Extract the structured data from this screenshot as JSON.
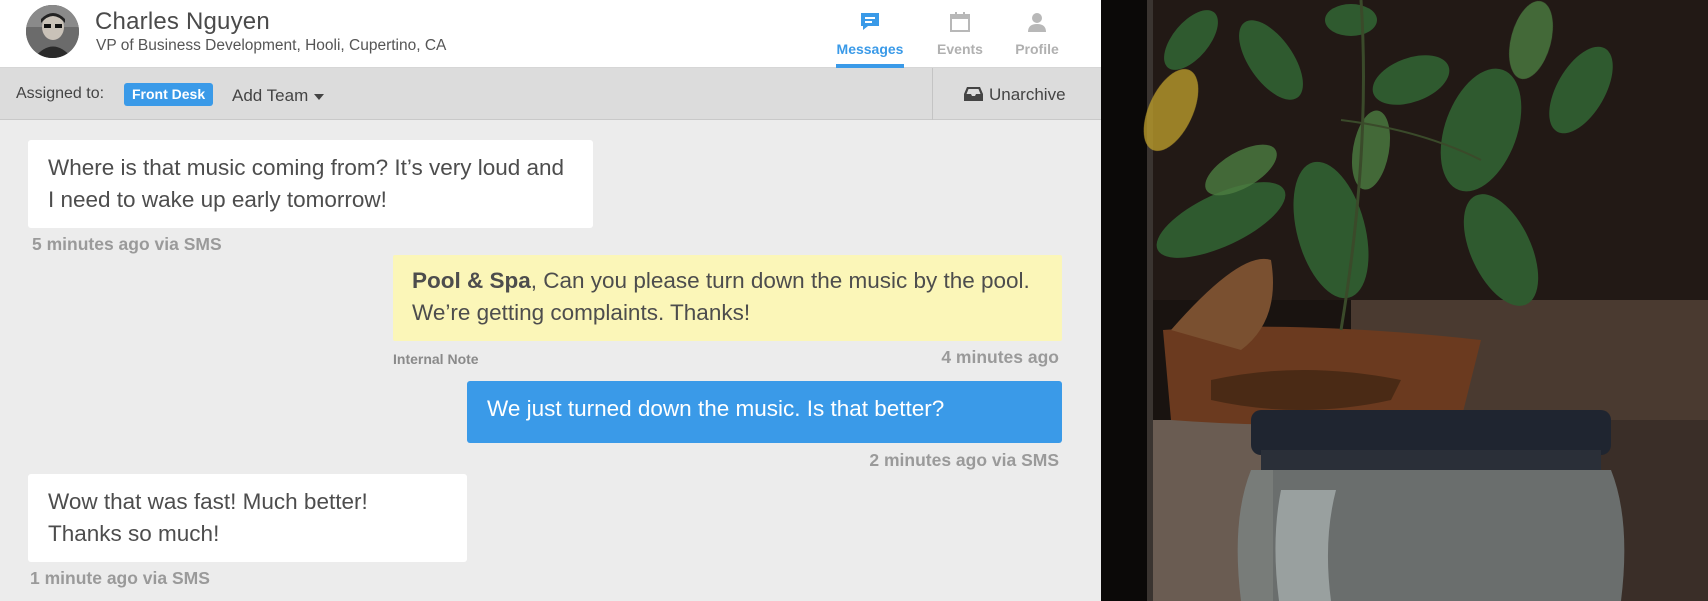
{
  "contact": {
    "name": "Charles Nguyen",
    "title": "VP of Business Development, Hooli, Cupertino, CA"
  },
  "tabs": [
    {
      "label": "Messages",
      "icon": "chat-bubble-icon",
      "active": true
    },
    {
      "label": "Events",
      "icon": "calendar-icon",
      "active": false
    },
    {
      "label": "Profile",
      "icon": "person-icon",
      "active": false
    }
  ],
  "assign_bar": {
    "label": "Assigned to:",
    "team_badge": "Front Desk",
    "add_team": "Add Team",
    "unarchive": "Unarchive"
  },
  "messages": [
    {
      "type": "incoming",
      "text": "Where is that music coming from? It’s very loud and I need to wake up early tomorrow!",
      "meta": "5 minutes ago via SMS"
    },
    {
      "type": "internal_note",
      "mention": "Pool & Spa",
      "text": ", Can you please turn down the music by the pool. We’re getting complaints. Thanks!",
      "note_label": "Internal Note",
      "meta": "4 minutes ago"
    },
    {
      "type": "outgoing",
      "text": "We just turned down the music. Is that better?",
      "meta": "2 minutes ago via SMS"
    },
    {
      "type": "incoming",
      "text": "Wow that was fast!  Much better! Thanks so much!",
      "meta": "1 minute ago via SMS"
    }
  ],
  "colors": {
    "accent": "#3a9ae8",
    "note_background": "#fbf6b8",
    "conversation_background": "#ececec"
  }
}
